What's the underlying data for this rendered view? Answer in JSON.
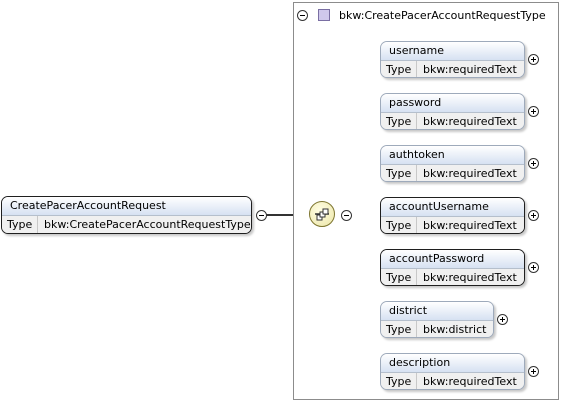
{
  "root": {
    "name": "CreatePacerAccountRequest",
    "type_label": "Type",
    "type_value": "bkw:CreatePacerAccountRequestType"
  },
  "complex_type": {
    "title": "bkw:CreatePacerAccountRequestType"
  },
  "elements": [
    {
      "name": "username",
      "type_label": "Type",
      "type_value": "bkw:requiredText"
    },
    {
      "name": "password",
      "type_label": "Type",
      "type_value": "bkw:requiredText"
    },
    {
      "name": "authtoken",
      "type_label": "Type",
      "type_value": "bkw:requiredText"
    },
    {
      "name": "accountUsername",
      "type_label": "Type",
      "type_value": "bkw:requiredText"
    },
    {
      "name": "accountPassword",
      "type_label": "Type",
      "type_value": "bkw:requiredText"
    },
    {
      "name": "district",
      "type_label": "Type",
      "type_value": "bkw:district"
    },
    {
      "name": "description",
      "type_label": "Type",
      "type_value": "bkw:requiredText"
    }
  ],
  "colors": {
    "element_header": "#d6e1f2",
    "type_swatch": "#cfc8ec",
    "sequence_compositor": "#ece6a8"
  }
}
